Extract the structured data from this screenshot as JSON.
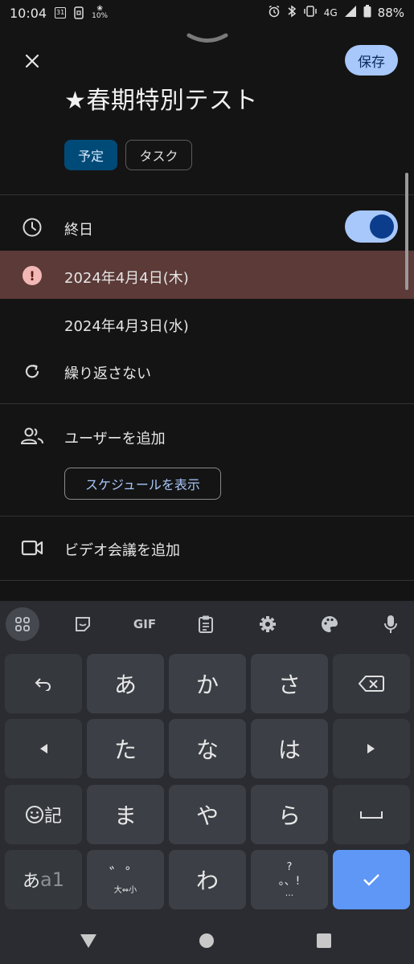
{
  "status_bar": {
    "time": "10:04",
    "calendar_day": "31",
    "small_label": "10%",
    "network": "4G",
    "battery": "88%"
  },
  "header": {
    "save_label": "保存",
    "title": "★春期特別テスト"
  },
  "type_chips": {
    "event_label": "予定",
    "task_label": "タスク"
  },
  "all_day": {
    "label": "終日",
    "enabled": true
  },
  "dates": {
    "start_date": "2024年4月4日(木)",
    "end_date": "2024年4月3日(水)"
  },
  "repeat": {
    "label": "繰り返さない"
  },
  "people": {
    "add_label": "ユーザーを追加",
    "schedule_button": "スケジュールを表示"
  },
  "video": {
    "label": "ビデオ会議を追加"
  },
  "keyboard": {
    "toolbar": [
      "grid-icon",
      "sticker-icon",
      "GIF",
      "clipboard-icon",
      "settings-icon",
      "palette-icon",
      "mic-icon"
    ],
    "gif_label": "GIF",
    "row1": {
      "k2": "あ",
      "k3": "か",
      "k4": "さ"
    },
    "row2": {
      "k2": "た",
      "k3": "な",
      "k4": "は"
    },
    "row3": {
      "k1": "記",
      "k2": "ま",
      "k3": "や",
      "k4": "ら"
    },
    "row4": {
      "k1a": "あ",
      "k1b": "a1",
      "k2": "゛゜",
      "k2b": "大⇔小",
      "k3": "わ",
      "k4a": "?",
      "k4b": "。、!",
      "k4c": "..."
    }
  },
  "colors": {
    "accent": "#a8c7fa",
    "error_row": "#5b3a37",
    "chip_selected": "#004a77",
    "enter_key": "#5e97f6"
  }
}
